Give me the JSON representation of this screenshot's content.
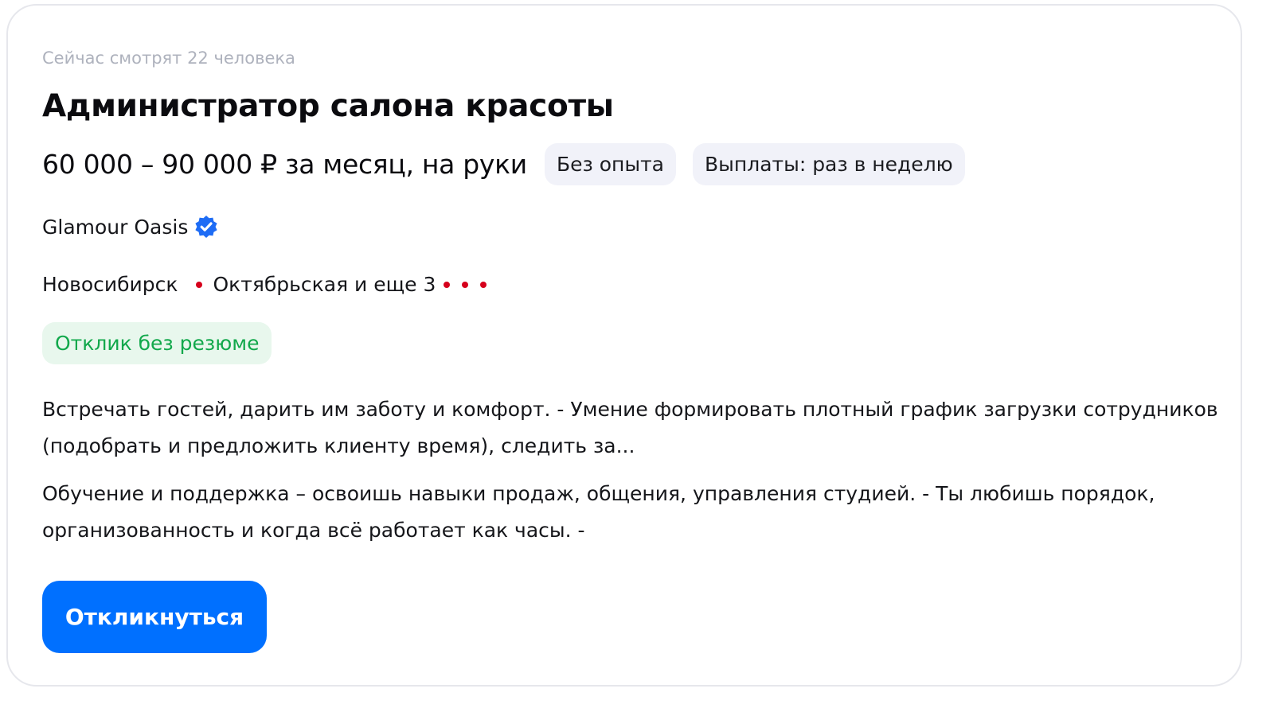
{
  "vacancy": {
    "viewers_text": "Сейчас смотрят 22 человека",
    "title": "Администратор салона красоты",
    "salary": "60 000 – 90 000 ₽ за месяц, на руки",
    "tags": [
      "Без опыта",
      "Выплаты: раз в неделю"
    ],
    "company": "Glamour Oasis",
    "company_verified": true,
    "city": "Новосибирск",
    "metro": "Октябрьская и еще 3",
    "no_resume_badge": "Отклик без резюме",
    "description": [
      "Встречать гостей, дарить им заботу и комфорт. - Умение формировать плотный график загрузки сотрудников (подобрать и предложить клиенту время), следить за...",
      "Обучение и поддержка – освоишь навыки продаж, общения, управления студией. - Ты любишь порядок, организованность и когда всё работает как часы. -"
    ],
    "apply_button": "Откликнуться"
  },
  "icons": {
    "verified": "verified-badge-icon",
    "metro": "metro-line-dot-icon"
  },
  "colors": {
    "accent": "#0070ff",
    "verified": "#1e6cf5",
    "metro_line": "#d6001c",
    "success_text": "#11a84b",
    "success_bg": "#e8f7ed",
    "tag_bg": "#f1f2f9",
    "muted_text": "#aeb2bd"
  }
}
